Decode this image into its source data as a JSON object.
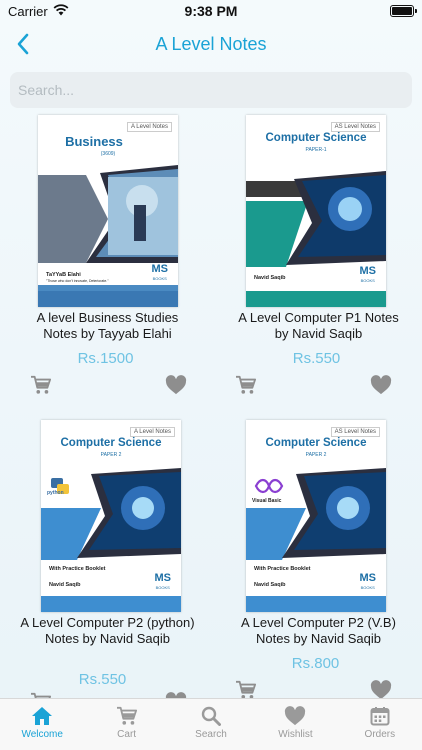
{
  "status": {
    "carrier": "Carrier",
    "time": "9:38 PM"
  },
  "nav": {
    "title": "A Level Notes"
  },
  "search": {
    "placeholder": "Search..."
  },
  "products": [
    {
      "title": "A level Business Studies Notes by Tayyab Elahi",
      "price": "Rs.1500",
      "cover": {
        "label": "A Level Notes",
        "title": "Business",
        "subtitle": "(3609)",
        "author": "TaYYaB Elahi",
        "tagline": "\"Those who don't innovate, Deteriorate.\"",
        "logo": "MS",
        "logo_sub": "BOOKS"
      }
    },
    {
      "title": "A Level Computer P1 Notes by Navid Saqib",
      "price": "Rs.550",
      "cover": {
        "label": "AS Level Notes",
        "title": "Computer Science",
        "subtitle": "PAPER-1",
        "author": "Navid Saqib",
        "logo": "MS",
        "logo_sub": "BOOKS"
      }
    },
    {
      "title": "A Level Computer P2 (python) Notes by Navid Saqib",
      "price": "Rs.550",
      "cover": {
        "label": "A Level Notes",
        "title": "Computer Science",
        "subtitle": "PAPER 2",
        "badge": "python",
        "booklet": "With Practice Booklet",
        "author": "Navid Saqib",
        "logo": "MS",
        "logo_sub": "BOOKS"
      }
    },
    {
      "title": "A Level Computer P2 (V.B) Notes by Navid Saqib",
      "price": "Rs.800",
      "cover": {
        "label": "AS Level Notes",
        "title": "Computer Science",
        "subtitle": "PAPER 2",
        "badge": "Visual Basic",
        "booklet": "With Practice Booklet",
        "author": "Navid Saqib",
        "logo": "MS",
        "logo_sub": "BOOKS"
      }
    }
  ],
  "tabs": [
    {
      "label": "Welcome",
      "icon": "home-icon",
      "active": true
    },
    {
      "label": "Cart",
      "icon": "cart-icon",
      "active": false
    },
    {
      "label": "Search",
      "icon": "search-icon",
      "active": false
    },
    {
      "label": "Wishlist",
      "icon": "heart-icon",
      "active": false
    },
    {
      "label": "Orders",
      "icon": "calendar-icon",
      "active": false
    }
  ],
  "colors": {
    "accent": "#1aa3d6",
    "price": "#6fc3e3",
    "icon_gray": "#8e8e8e"
  }
}
